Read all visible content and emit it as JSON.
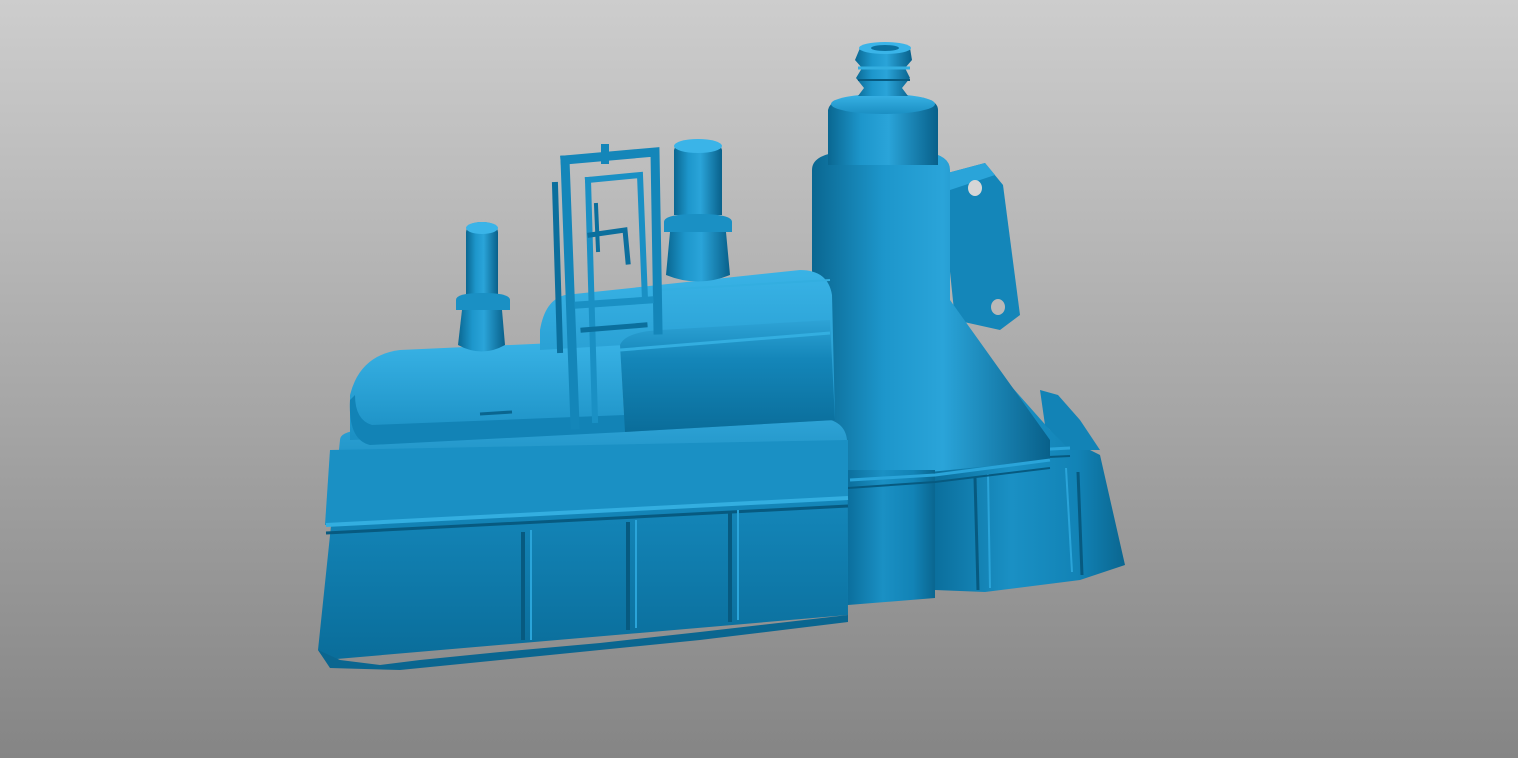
{
  "scene": {
    "model_color": "#0e7aa8",
    "highlight_color": "#33aee0",
    "shadow_color": "#075a80",
    "background_top": "#cdcdcd",
    "background_bottom": "#858585"
  }
}
